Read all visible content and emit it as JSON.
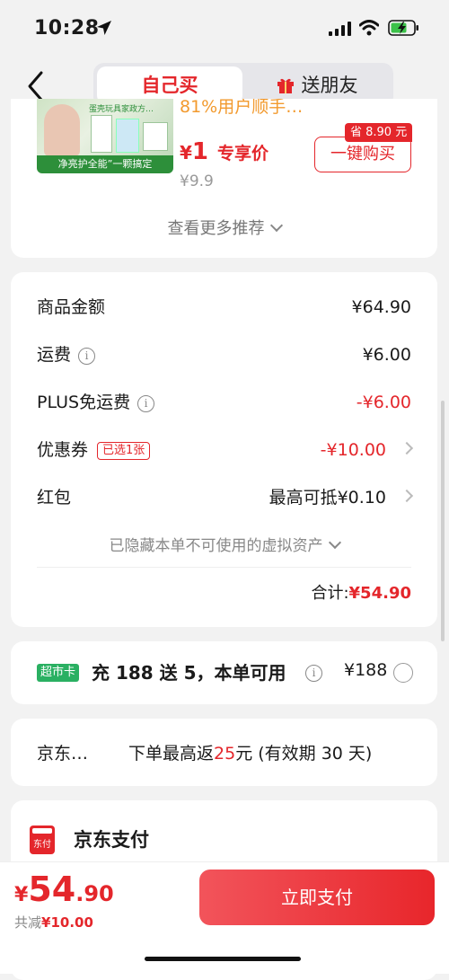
{
  "status": {
    "time": "10:28"
  },
  "header": {
    "tab_self": "自己买",
    "tab_gift": "送朋友"
  },
  "product": {
    "title": "81%用户顺手…",
    "image_tag": "蛋壳玩具家政方…",
    "image_caption": "净亮护全能”一颗搞定",
    "price_symbol": "¥",
    "price": "1",
    "price_label": "专享价",
    "orig_price": "¥9.9",
    "save_badge": "省 8.90 元",
    "buy_button": "一键购买",
    "more_recs": "查看更多推荐"
  },
  "summary": {
    "goods_label": "商品金额",
    "goods_value": "¥64.90",
    "shipping_label": "运费",
    "shipping_value": "¥6.00",
    "plus_label": "PLUS免运费",
    "plus_value": "-¥6.00",
    "coupon_label": "优惠券",
    "coupon_badge": "已选1张",
    "coupon_value": "-¥10.00",
    "redpacket_label": "红包",
    "redpacket_value": "最高可抵¥0.10",
    "hidden_assets": "已隐藏本单不可使用的虚拟资产",
    "total_label": "合计:",
    "total_value": "¥54.90"
  },
  "supermarket": {
    "badge": "超市卡",
    "text": "充 188 送 5，本单可用",
    "price": "¥188"
  },
  "rebate": {
    "label": "京东…",
    "text_pre": "下单最高返",
    "text_num": "25",
    "text_post": "元 (有效期 30 天)"
  },
  "payment": {
    "icon_text": "东付",
    "method": "京东支付"
  },
  "bottom": {
    "symbol": "¥",
    "amount_int": "54",
    "amount_dec": ".90",
    "saved_label": "共减",
    "saved_value": "¥10.00",
    "pay_button": "立即支付"
  },
  "colors": {
    "accent": "#e4262b",
    "orange": "#f29a2e",
    "green": "#2ab062"
  }
}
